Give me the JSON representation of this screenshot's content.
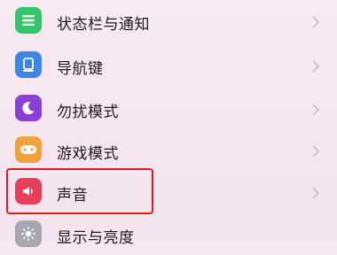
{
  "settings": {
    "items": [
      {
        "label": "状态栏与通知",
        "icon": "notification-bar-icon",
        "color": "#35c66b"
      },
      {
        "label": "导航键",
        "icon": "navigation-key-icon",
        "color": "#3e86e6"
      },
      {
        "label": "勿扰模式",
        "icon": "moon-icon",
        "color": "#8a3fd6"
      },
      {
        "label": "游戏模式",
        "icon": "gamepad-icon",
        "color": "#f2a23a"
      },
      {
        "label": "声音",
        "icon": "speaker-icon",
        "color": "#e8405a"
      },
      {
        "label": "显示与亮度",
        "icon": "sun-icon",
        "color": "#a7a7b0"
      }
    ]
  },
  "highlight": {
    "target": "声音",
    "color": "#e01a1a"
  }
}
